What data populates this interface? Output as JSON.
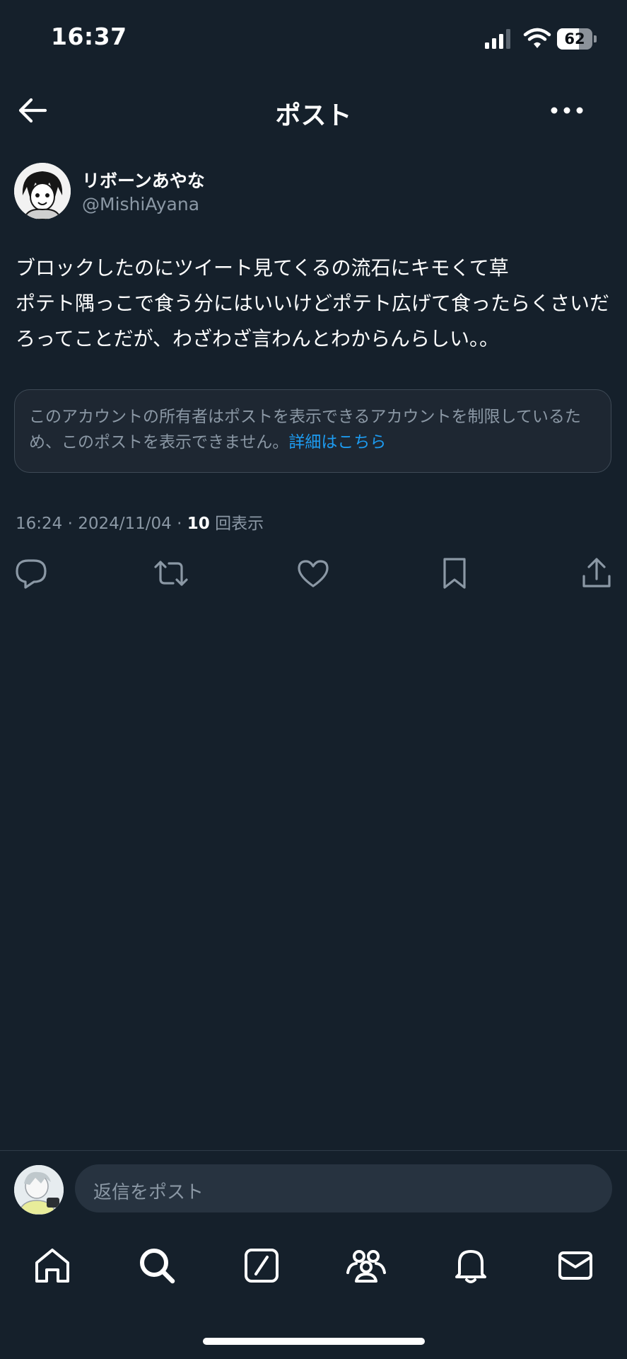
{
  "status_bar": {
    "time": "16:37",
    "battery": "62",
    "battery_level": 0.62
  },
  "header": {
    "title": "ポスト"
  },
  "post": {
    "display_name": "リボーンあやな",
    "handle": "@MishiAyana",
    "text": "ブロックしたのにツイート見てくるの流石にキモくて草\nポテト隅っこで食う分にはいいけどポテト広げて食ったらくさいだろってことだが、わざわざ言わんとわからんらしい。。",
    "notice": "このアカウントの所有者はポストを表示できるアカウントを制限しているため、このポストを表示できません。",
    "notice_link": "詳細はこちら",
    "time": "16:24",
    "date": "2024/11/04",
    "views_count": "10",
    "views_label": "回表示"
  },
  "reply": {
    "placeholder": "返信をポスト"
  },
  "icons": {
    "actions": [
      "reply-icon",
      "repost-icon",
      "like-icon",
      "bookmark-icon",
      "share-icon"
    ],
    "nav": [
      "home-icon",
      "search-icon",
      "grok-icon",
      "communities-icon",
      "notifications-icon",
      "messages-icon"
    ]
  },
  "colors": {
    "background": "#15202b",
    "link": "#1d9bf0",
    "secondary_text": "#8b98a5"
  }
}
